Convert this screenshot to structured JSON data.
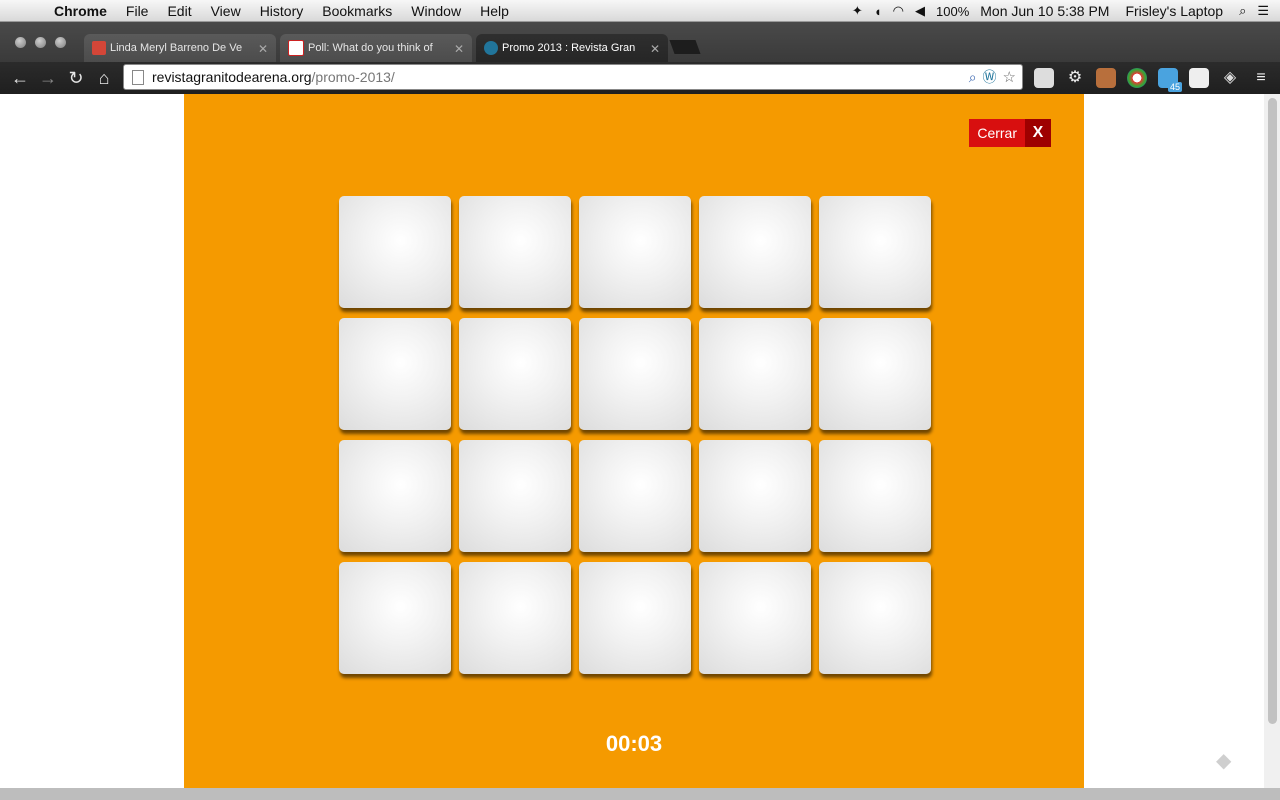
{
  "menubar": {
    "app": "Chrome",
    "items": [
      "File",
      "Edit",
      "View",
      "History",
      "Bookmarks",
      "Window",
      "Help"
    ],
    "battery": "100%",
    "datetime": "Mon Jun 10  5:38 PM",
    "user": "Frisley's Laptop"
  },
  "tabs": [
    {
      "title": "Linda Meryl Barreno De Ve",
      "favicon": "gmail-icon",
      "color": "#d44638"
    },
    {
      "title": "Poll: What do you think of",
      "favicon": "tmw-icon",
      "color": "#c22"
    },
    {
      "title": "Promo 2013 : Revista Gran",
      "favicon": "wordpress-icon",
      "color": "#21759b"
    }
  ],
  "address": {
    "host": "revistagranitodearena.org",
    "path": "/promo-2013/"
  },
  "extension_badge": "45",
  "promo": {
    "background": "#f59a00",
    "close_label": "Cerrar",
    "close_x": "X",
    "timer": "00:03",
    "grid": {
      "rows": 4,
      "cols": 5
    }
  }
}
